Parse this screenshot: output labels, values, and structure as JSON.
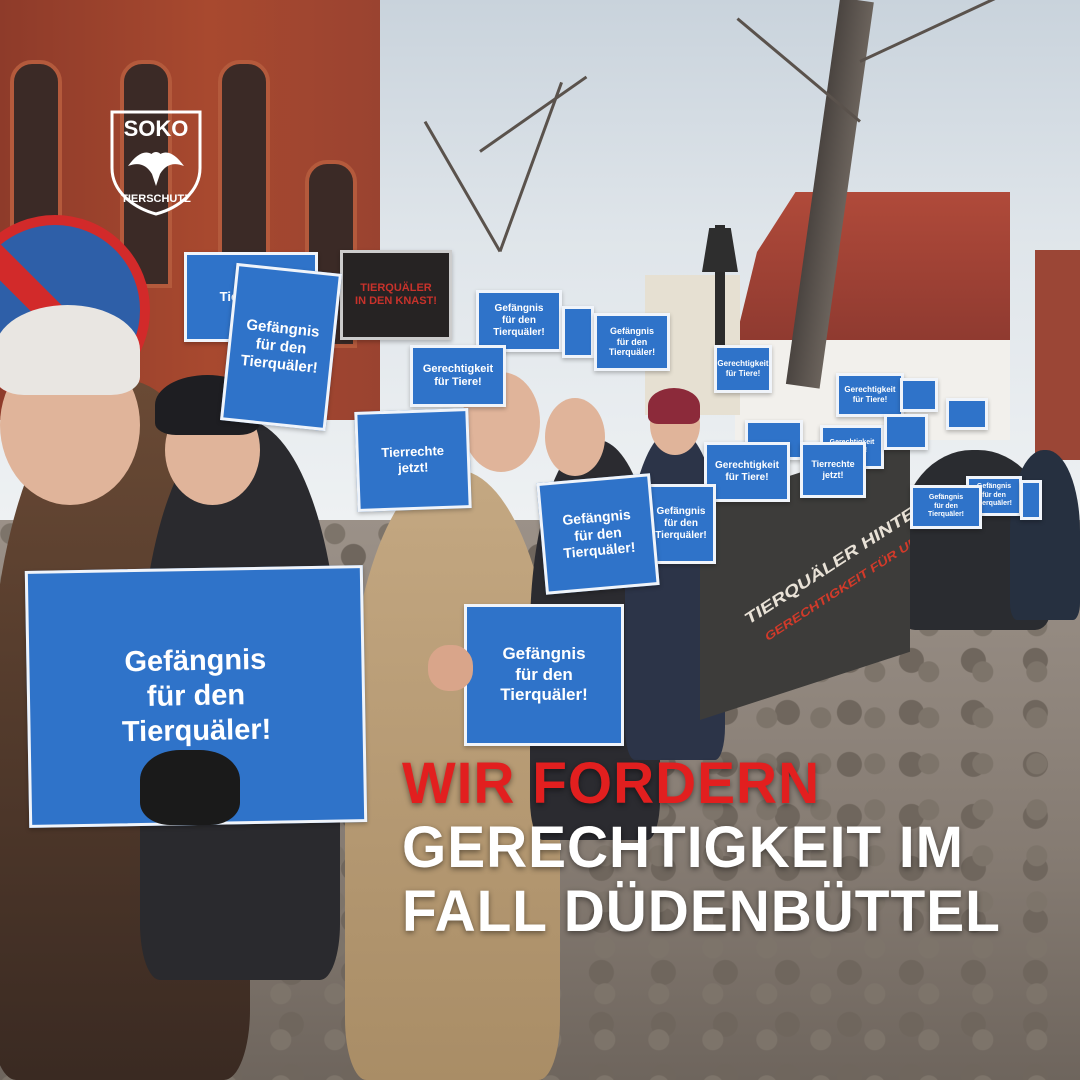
{
  "logo": {
    "name": "SOKO",
    "subtitle": "TIERSCHUTZ",
    "icon": "eagle-shield-icon"
  },
  "signs": [
    "Gefängnis\nfür den\nTierquäler!",
    "Gefängnis\nfür den\nTierquäler!",
    "Gefängnis\nfür den\nTierquäler!",
    "Tierrechte",
    "TIERQUÄLER\nIN DEN KNAST!",
    "Gefängnis\nfür den\nTierquäler!",
    "Gefängnis\nfür den\nTierquäler!",
    "Gerechtigkeit\nfür Tiere!",
    "Gerechtigkeit\nfür Tiere!",
    "Tierrechte\njetzt!",
    "Gefängnis\nfür den\nTierquäler!",
    "Gerechtigkeit\nfür Tiere!",
    "Gerechtigkeit\nfür Tiere!",
    "Tierrechte\njetzt!",
    "Gerechtigkeit\nfür Tiere!",
    "Gefängnis\nfür den\nTierquäler!",
    "Gefängnis\nfür den\nTierquäler!",
    "Gefängnis\nfür den\nTierquäler!"
  ],
  "banner": {
    "text": "TIERQUÄLER HINTER GITTER",
    "subtext": "GERECHTIGKEIT FÜR UNSERE TIERE"
  },
  "headline": {
    "line1": "WIR FORDERN",
    "line2": "GERECHTIGKEIT IM",
    "line3": "FALL DÜDENBÜTTEL"
  },
  "colors": {
    "sign_blue": "#2f73c9",
    "headline_red": "#e21f1f",
    "headline_white": "#ffffff"
  }
}
